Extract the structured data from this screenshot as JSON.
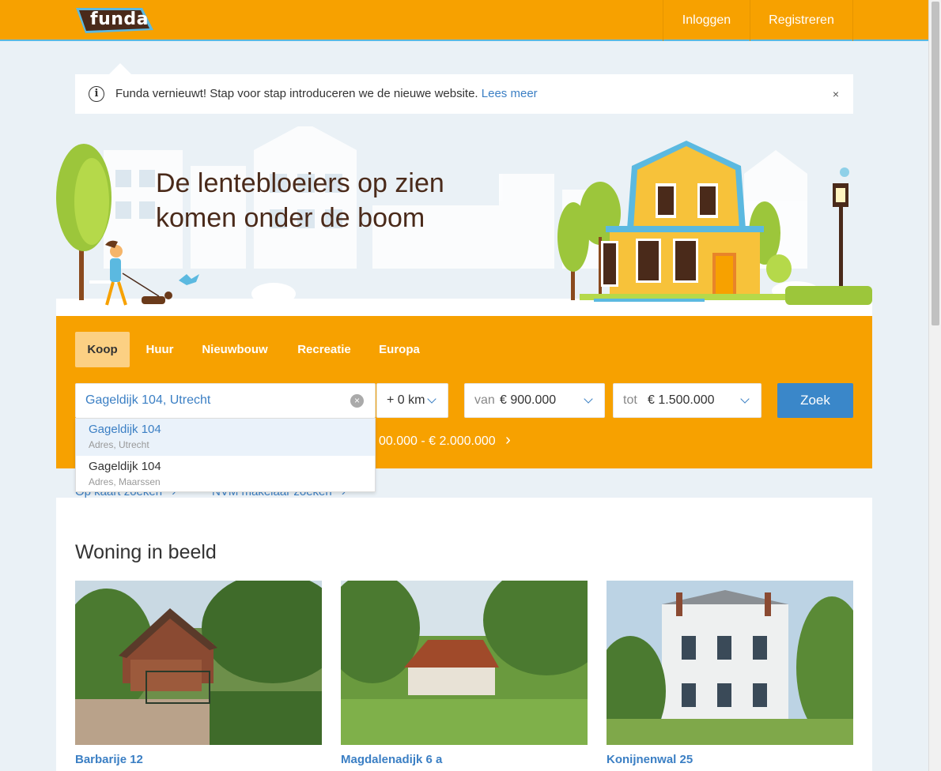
{
  "header": {
    "logo_text": "funda",
    "login_label": "Inloggen",
    "register_label": "Registreren"
  },
  "notice": {
    "text": "Funda vernieuwt! Stap voor stap introduceren we de nieuwe website.",
    "link_label": "Lees meer",
    "info_icon": "i",
    "close_icon": "×"
  },
  "hero": {
    "title_line1": "De lentebloeiers op zien",
    "title_line2": "komen onder de boom"
  },
  "search": {
    "tabs": [
      {
        "label": "Koop",
        "active": true
      },
      {
        "label": "Huur",
        "active": false
      },
      {
        "label": "Nieuwbouw",
        "active": false
      },
      {
        "label": "Recreatie",
        "active": false
      },
      {
        "label": "Europa",
        "active": false
      }
    ],
    "location_value": "Gageldijk 104, Utrecht",
    "radius_value": "+ 0 km",
    "min_label": "van",
    "min_value": "€ 900.000",
    "max_label": "tot",
    "max_value": "€ 1.500.000",
    "submit_label": "Zoek",
    "recent_text": "00.000 - € 2.000.000",
    "recent_chevron": "›"
  },
  "autocomplete": {
    "items": [
      {
        "title": "Gageldijk 104",
        "subtitle": "Adres, Utrecht",
        "highlighted": true
      },
      {
        "title": "Gageldijk 104",
        "subtitle": "Adres, Maarssen",
        "highlighted": false
      }
    ]
  },
  "links": {
    "map_search": "Op kaart zoeken",
    "nvm_search": "NVM makelaar zoeken",
    "chevron": "›"
  },
  "featured": {
    "title": "Woning in beeld",
    "cards": [
      {
        "title": "Barbarije 12"
      },
      {
        "title": "Magdalenadijk 6 a"
      },
      {
        "title": "Konijnenwal 25"
      }
    ]
  },
  "colors": {
    "brand_orange": "#f7a100",
    "link_blue": "#3b7fc4",
    "button_blue": "#3a87c9",
    "title_brown": "#4a2a1a"
  }
}
